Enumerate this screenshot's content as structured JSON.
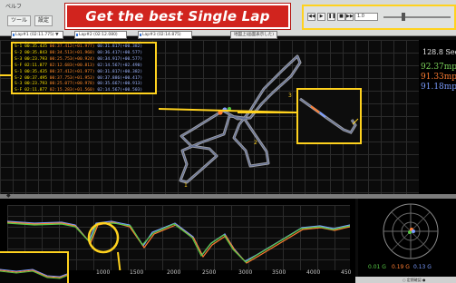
{
  "menubar": {
    "text": "ベルフ",
    "buttons": [
      "ツール",
      "設定"
    ]
  },
  "headline": "Get the best Single Lap",
  "playback": {
    "speed": "1.0"
  },
  "subbar": {
    "selectors": [
      "Lap#1 (02:11.775) ▼",
      "Lap#2 (02:12.080)",
      "Lap#3 (02:14.875)"
    ],
    "map_button": "地図上(画面表示した)"
  },
  "lap_table": {
    "rows": [
      {
        "c1": "S-1 00:35.435",
        "c2": "00:37.412(+01.977)",
        "c3": "00:31.817(+00.382)"
      },
      {
        "c1": "S-2 00:35.843",
        "c2": "00:34.513(+01.960)",
        "c3": "00:36.417(+00.577)"
      },
      {
        "c1": "S-3 00:23.793",
        "c2": "00:25.753(+00.924)",
        "c3": "00:34.917(+00.577)"
      },
      {
        "c1": "S-F 02:11.877",
        "c2": "02:12.683(+00.813)",
        "c3": "02:14.567(+02.490)"
      },
      {
        "c1": "S-1 00:35.435",
        "c2": "00:37.412(+01.977)",
        "c3": "00:31.817(+00.382)"
      },
      {
        "c1": "S-2 00:37.495",
        "c2": "00:37.753(+01.953)",
        "c3": "00:37.886(+00.417)"
      },
      {
        "c1": "S-3 00:23.793",
        "c2": "00:25.077(+00.978)",
        "c3": "00:35.667(+00.913)"
      },
      {
        "c1": "S-F 02:11.877",
        "c2": "02:15.283(+01.560)",
        "c3": "02:14.567(+00.503)"
      }
    ]
  },
  "right_panel": {
    "total_time": "128.8 Sec",
    "speeds": [
      {
        "text": "92.37mph",
        "color": "#7cd35a"
      },
      {
        "text": "91.33mph",
        "color": "#ff7d32"
      },
      {
        "text": "91.18mph",
        "color": "#7a9cff"
      }
    ]
  },
  "track": {
    "markers": [
      "1",
      "2",
      "3"
    ]
  },
  "graph": {
    "x_ticks": [
      "1000",
      "1500",
      "2000",
      "2500",
      "3000",
      "3500",
      "4000",
      "450"
    ]
  },
  "gforce": [
    {
      "text": "0.01 G",
      "color": "#56c845"
    },
    {
      "text": "0.19 G",
      "color": "#ff7d32"
    },
    {
      "text": "0.13 G",
      "color": "#7a9cff"
    }
  ],
  "status": "○ 定期確認 ●"
}
